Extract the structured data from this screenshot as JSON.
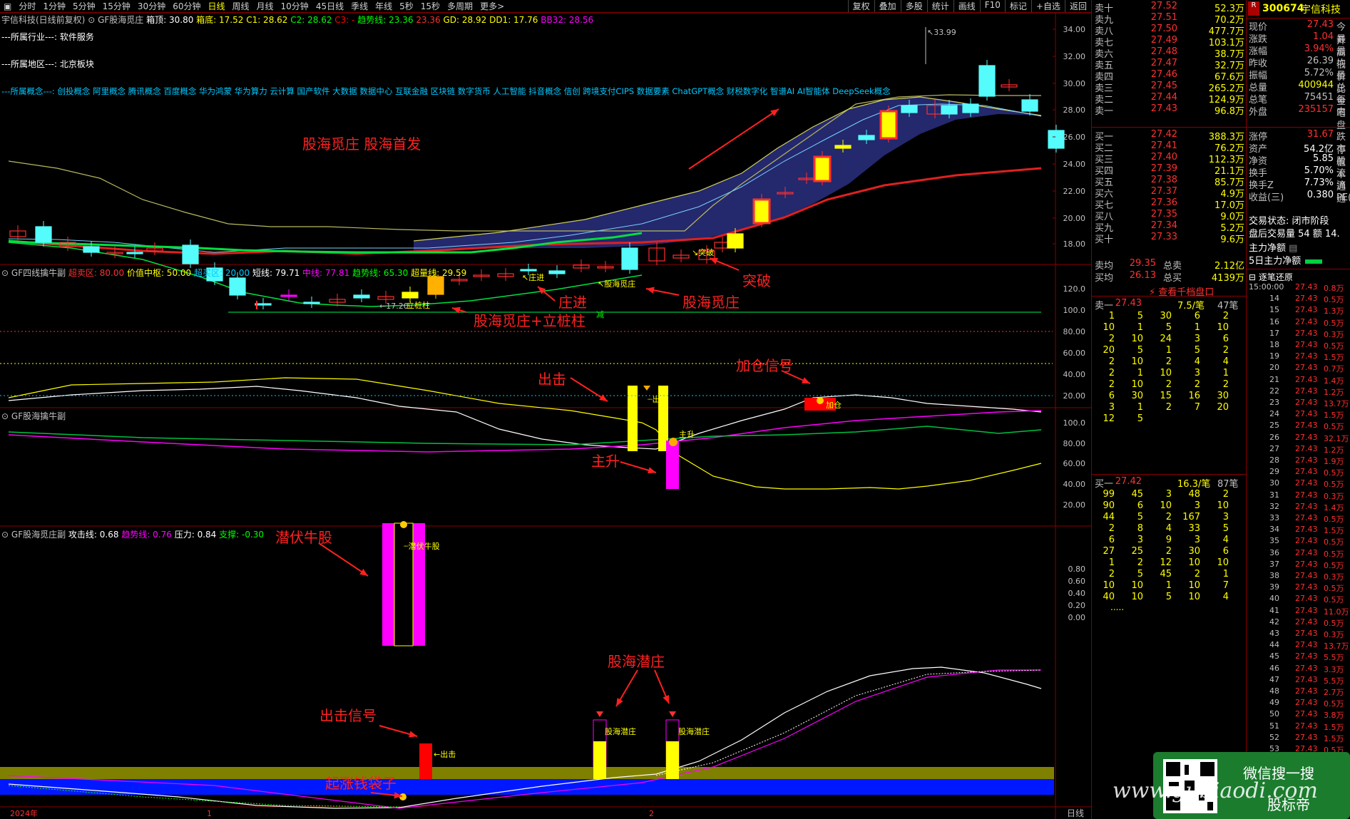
{
  "toolbar": {
    "periods": [
      "分时",
      "1分钟",
      "5分钟",
      "15分钟",
      "30分钟",
      "60分钟",
      "日线",
      "周线",
      "月线",
      "10分钟",
      "45日线",
      "季线",
      "年线",
      "5秒",
      "15秒",
      "多周期",
      "更多>"
    ],
    "active": "日线",
    "right_buttons": [
      "复权",
      "叠加",
      "多股",
      "统计",
      "画线",
      "F10",
      "标记",
      "+自选",
      "返回"
    ]
  },
  "main_title": {
    "name": "宇信科技(日线前复权)",
    "indicator": "GF股海觅庄",
    "items": [
      {
        "t": "箱顶: 30.80",
        "c": "#ffffff"
      },
      {
        "t": "箱底: 17.52",
        "c": "#ffff00"
      },
      {
        "t": "C1: 28.62",
        "c": "#ffff00"
      },
      {
        "t": "C2: 28.62",
        "c": "#00ff00"
      },
      {
        "t": "C3: -",
        "c": "#ff0000"
      },
      {
        "t": "趋势线: 23.36",
        "c": "#00ff00"
      },
      {
        "t": "23.36",
        "c": "#ff3030"
      },
      {
        "t": "GD: 28.92",
        "c": "#ffff00"
      },
      {
        "t": "DD1: 17.76",
        "c": "#ffff00"
      },
      {
        "t": "BB32: 28.56",
        "c": "#ff00ff"
      }
    ]
  },
  "info_lines": {
    "industry": "---所属行业---: 软件服务",
    "region": "---所属地区---: 北京板块",
    "concepts_label": "---所属概念---:",
    "concepts": "创投概念 阿里概念 腾讯概念 百度概念 华为鸿蒙 华为算力 云计算 国产软件 大数据 数据中心 互联金融 区块链 数字货币 人工智能 抖音概念 信创 跨境支付CIPS 数据要素 ChatGPT概念 财税数字化 智谱AI AI智能体 DeepSeek概念"
  },
  "panel_titles": {
    "p2": "GF四线擒牛副",
    "p2_items": [
      {
        "t": "超卖区: 80.00",
        "c": "#ff3030"
      },
      {
        "t": "价值中枢: 50.00",
        "c": "#ffff00"
      },
      {
        "t": "超买区: 20.00",
        "c": "#00c8ff"
      },
      {
        "t": "短线: 79.71",
        "c": "#ffffff"
      },
      {
        "t": "中线: 77.81",
        "c": "#ff00ff"
      },
      {
        "t": "趋势线: 65.30",
        "c": "#00ff00"
      },
      {
        "t": "超量线: 29.59",
        "c": "#ffff00"
      }
    ],
    "p3": "GF股海擒牛副",
    "p4": "GF股海觅庄副",
    "p4_items": [
      {
        "t": "攻击线: 0.68",
        "c": "#ffffff"
      },
      {
        "t": "趋势线: 0.76",
        "c": "#ff00ff"
      },
      {
        "t": "压力: 0.84",
        "c": "#ffffff"
      },
      {
        "t": "支撑: -0.30",
        "c": "#00ff00"
      }
    ]
  },
  "axes": {
    "p1": [
      "34.00",
      "32.00",
      "30.00",
      "28.00",
      "26.00",
      "24.00",
      "22.00",
      "20.00",
      "18.00"
    ],
    "p2": [
      "120.0",
      "100.0",
      "80.00",
      "60.00",
      "40.00",
      "20.00"
    ],
    "p3": [
      "100.0",
      "80.00",
      "60.00",
      "40.00",
      "20.00"
    ],
    "p4": [
      "0.80",
      "0.60",
      "0.40",
      "0.20",
      "0.00"
    ],
    "dates": [
      "2024年",
      "1",
      "2"
    ],
    "period_label": "日线"
  },
  "chart_labels": {
    "high": "33.99",
    "low": "17.20",
    "zhuangjin": "庄进",
    "tupo": "突破",
    "guhai_mizhuang": "股海觅庄",
    "lizhuangzhu": "立桩柱",
    "chuji": "出击",
    "zhusheng": "主升",
    "jiacang": "加仓",
    "qianfu": "潜伏牛股",
    "qianzhuang": "股海潜庄",
    "chu": "出击",
    "jian": "减"
  },
  "annotations": {
    "headline": "股海觅庄  股海首发",
    "zhuangjin": "庄进",
    "guhai_mizhuang": "股海觅庄",
    "tupo": "突破",
    "mizhuang_lizhuang": "股海觅庄+立桩柱",
    "chuji": "出击",
    "jiacang": "加仓信号",
    "zhusheng": "主升",
    "qianfu": "潜伏牛股",
    "qianzhuang": "股海潜庄",
    "chuji_signal": "出击信号",
    "qizhang": "起涨钱袋子"
  },
  "order_book": {
    "asks": [
      {
        "lab": "卖十",
        "px": "27.52",
        "vol": "52.3万"
      },
      {
        "lab": "卖九",
        "px": "27.51",
        "vol": "70.2万"
      },
      {
        "lab": "卖八",
        "px": "27.50",
        "vol": "477.7万"
      },
      {
        "lab": "卖七",
        "px": "27.49",
        "vol": "103.1万"
      },
      {
        "lab": "卖六",
        "px": "27.48",
        "vol": "38.7万"
      },
      {
        "lab": "卖五",
        "px": "27.47",
        "vol": "32.7万"
      },
      {
        "lab": "卖四",
        "px": "27.46",
        "vol": "67.6万"
      },
      {
        "lab": "卖三",
        "px": "27.45",
        "vol": "265.2万"
      },
      {
        "lab": "卖二",
        "px": "27.44",
        "vol": "124.9万"
      },
      {
        "lab": "卖一",
        "px": "27.43",
        "vol": "96.8万"
      }
    ],
    "bids": [
      {
        "lab": "买一",
        "px": "27.42",
        "vol": "388.3万"
      },
      {
        "lab": "买二",
        "px": "27.41",
        "vol": "76.2万"
      },
      {
        "lab": "买三",
        "px": "27.40",
        "vol": "112.3万"
      },
      {
        "lab": "买四",
        "px": "27.39",
        "vol": "21.1万"
      },
      {
        "lab": "买五",
        "px": "27.38",
        "vol": "85.7万"
      },
      {
        "lab": "买六",
        "px": "27.37",
        "vol": "4.9万"
      },
      {
        "lab": "买七",
        "px": "27.36",
        "vol": "17.0万"
      },
      {
        "lab": "买八",
        "px": "27.35",
        "vol": "9.0万"
      },
      {
        "lab": "买九",
        "px": "27.34",
        "vol": "5.2万"
      },
      {
        "lab": "买十",
        "px": "27.33",
        "vol": "9.6万"
      }
    ],
    "avg": [
      {
        "lab": "卖均",
        "px": "29.35",
        "lab2": "总卖",
        "vol": "2.12亿"
      },
      {
        "lab": "买均",
        "px": "26.13",
        "lab2": "总买",
        "vol": "4139万"
      }
    ],
    "qianfang": "查看千档盘口",
    "sell1": {
      "lab": "卖一",
      "px": "27.43",
      "per": "7.5/笔",
      "cnt": "47笔"
    },
    "sell_queue": [
      [
        "1",
        "5",
        "30",
        "6",
        "2"
      ],
      [
        "10",
        "1",
        "5",
        "1",
        "10"
      ],
      [
        "2",
        "10",
        "24",
        "3",
        "6"
      ],
      [
        "20",
        "5",
        "1",
        "5",
        "2"
      ],
      [
        "2",
        "10",
        "2",
        "4",
        "4"
      ],
      [
        "2",
        "1",
        "10",
        "3",
        "1"
      ],
      [
        "2",
        "10",
        "2",
        "2",
        "2"
      ],
      [
        "6",
        "30",
        "15",
        "16",
        "30"
      ],
      [
        "3",
        "1",
        "2",
        "7",
        "20"
      ],
      [
        "12",
        "5",
        "",
        "",
        ""
      ]
    ],
    "buy1": {
      "lab": "买一",
      "px": "27.42",
      "per": "16.3/笔",
      "cnt": "87笔"
    },
    "buy_queue": [
      [
        "99",
        "45",
        "3",
        "48",
        "2"
      ],
      [
        "90",
        "6",
        "10",
        "3",
        "10"
      ],
      [
        "44",
        "5",
        "2",
        "167",
        "3"
      ],
      [
        "2",
        "8",
        "4",
        "33",
        "5"
      ],
      [
        "6",
        "3",
        "9",
        "3",
        "4"
      ],
      [
        "27",
        "25",
        "2",
        "30",
        "6"
      ],
      [
        "1",
        "2",
        "12",
        "10",
        "10"
      ],
      [
        "2",
        "5",
        "45",
        "2",
        "1"
      ],
      [
        "10",
        "10",
        "1",
        "10",
        "7"
      ],
      [
        "40",
        "10",
        "5",
        "10",
        "4"
      ]
    ],
    "more": "....."
  },
  "quote": {
    "code": "300674",
    "name": "宇信科技",
    "rows": [
      {
        "l": "现价",
        "v": "27.43",
        "c": "#ff3030",
        "x": "今开"
      },
      {
        "l": "涨跌",
        "v": "1.04",
        "c": "#ff3030",
        "x": "最高"
      },
      {
        "l": "涨幅",
        "v": "3.94%",
        "c": "#ff3030",
        "x": "最低"
      },
      {
        "l": "昨收",
        "v": "26.39",
        "c": "#c0c0c0",
        "x": "均价"
      },
      {
        "l": "振幅",
        "v": "5.72%",
        "c": "#c0c0c0",
        "x": "量比"
      },
      {
        "l": "总量",
        "v": "400944",
        "c": "#ffff00",
        "x": "总金"
      },
      {
        "l": "总笔",
        "v": "75451",
        "c": "#c0c0c0",
        "x": "每笔"
      },
      {
        "l": "外盘",
        "v": "235157",
        "c": "#ff3030",
        "x": "内盘"
      },
      {
        "l": "涨停",
        "v": "31.67",
        "c": "#ff3030",
        "x": "跌停"
      },
      {
        "l": "资产",
        "v": "54.2亿",
        "c": "#ffffff",
        "x": "市值"
      },
      {
        "l": "净资",
        "v": "5.85",
        "c": "#ffffff",
        "x": "股本"
      },
      {
        "l": "换手",
        "v": "5.70%",
        "c": "#ffffff",
        "x": "流通"
      },
      {
        "l": "换手Z",
        "v": "7.73%",
        "c": "#ffffff",
        "x": "流通"
      },
      {
        "l": "收益(三)",
        "v": "0.380",
        "c": "#ffffff",
        "x": "PE(动"
      }
    ],
    "status": "交易状态: 闭市阶段",
    "after": "盘后交易量 54 额 14.",
    "main_net": "主力净额",
    "five_day": "5日主力净额",
    "ticks_title": "逐笔还原",
    "ticks": [
      {
        "t": "15:00:00",
        "p": "27.43",
        "v": "0.8万"
      },
      {
        "t": "14",
        "p": "27.43",
        "v": "0.5万"
      },
      {
        "t": "15",
        "p": "27.43",
        "v": "1.3万"
      },
      {
        "t": "16",
        "p": "27.43",
        "v": "0.5万"
      },
      {
        "t": "17",
        "p": "27.43",
        "v": "0.3万"
      },
      {
        "t": "18",
        "p": "27.43",
        "v": "0.5万"
      },
      {
        "t": "19",
        "p": "27.43",
        "v": "1.5万"
      },
      {
        "t": "20",
        "p": "27.43",
        "v": "0.7万"
      },
      {
        "t": "21",
        "p": "27.43",
        "v": "1.4万"
      },
      {
        "t": "22",
        "p": "27.43",
        "v": "1.2万"
      },
      {
        "t": "23",
        "p": "27.43",
        "v": "13.7万"
      },
      {
        "t": "24",
        "p": "27.43",
        "v": "1.5万"
      },
      {
        "t": "25",
        "p": "27.43",
        "v": "0.5万"
      },
      {
        "t": "26",
        "p": "27.43",
        "v": "32.1万"
      },
      {
        "t": "27",
        "p": "27.43",
        "v": "1.2万"
      },
      {
        "t": "28",
        "p": "27.43",
        "v": "1.9万"
      },
      {
        "t": "29",
        "p": "27.43",
        "v": "0.5万"
      },
      {
        "t": "30",
        "p": "27.43",
        "v": "0.5万"
      },
      {
        "t": "31",
        "p": "27.43",
        "v": "0.3万"
      },
      {
        "t": "32",
        "p": "27.43",
        "v": "1.4万"
      },
      {
        "t": "33",
        "p": "27.43",
        "v": "0.5万"
      },
      {
        "t": "34",
        "p": "27.43",
        "v": "1.5万"
      },
      {
        "t": "35",
        "p": "27.43",
        "v": "0.5万"
      },
      {
        "t": "36",
        "p": "27.43",
        "v": "0.5万"
      },
      {
        "t": "37",
        "p": "27.43",
        "v": "0.5万"
      },
      {
        "t": "38",
        "p": "27.43",
        "v": "0.3万"
      },
      {
        "t": "39",
        "p": "27.43",
        "v": "0.5万"
      },
      {
        "t": "40",
        "p": "27.43",
        "v": "0.5万"
      },
      {
        "t": "41",
        "p": "27.43",
        "v": "11.0万"
      },
      {
        "t": "42",
        "p": "27.43",
        "v": "0.5万"
      },
      {
        "t": "43",
        "p": "27.43",
        "v": "0.3万"
      },
      {
        "t": "44",
        "p": "27.43",
        "v": "13.7万"
      },
      {
        "t": "45",
        "p": "27.43",
        "v": "5.5万"
      },
      {
        "t": "46",
        "p": "27.43",
        "v": "3.3万"
      },
      {
        "t": "47",
        "p": "27.43",
        "v": "5.5万"
      },
      {
        "t": "48",
        "p": "27.43",
        "v": "2.7万"
      },
      {
        "t": "49",
        "p": "27.43",
        "v": "0.5万"
      },
      {
        "t": "50",
        "p": "27.43",
        "v": "3.8万"
      },
      {
        "t": "51",
        "p": "27.43",
        "v": "1.5万"
      },
      {
        "t": "52",
        "p": "27.43",
        "v": "1.5万"
      },
      {
        "t": "53",
        "p": "27.43",
        "v": "0.5万"
      }
    ]
  },
  "watermark": {
    "search": "微信搜一搜",
    "site": "www.gubiaodi.com",
    "brand": "股标帝"
  },
  "colors": {
    "up": "#ff3030",
    "down": "#54fcfc",
    "bg": "#000000",
    "grid": "#8a0000"
  }
}
